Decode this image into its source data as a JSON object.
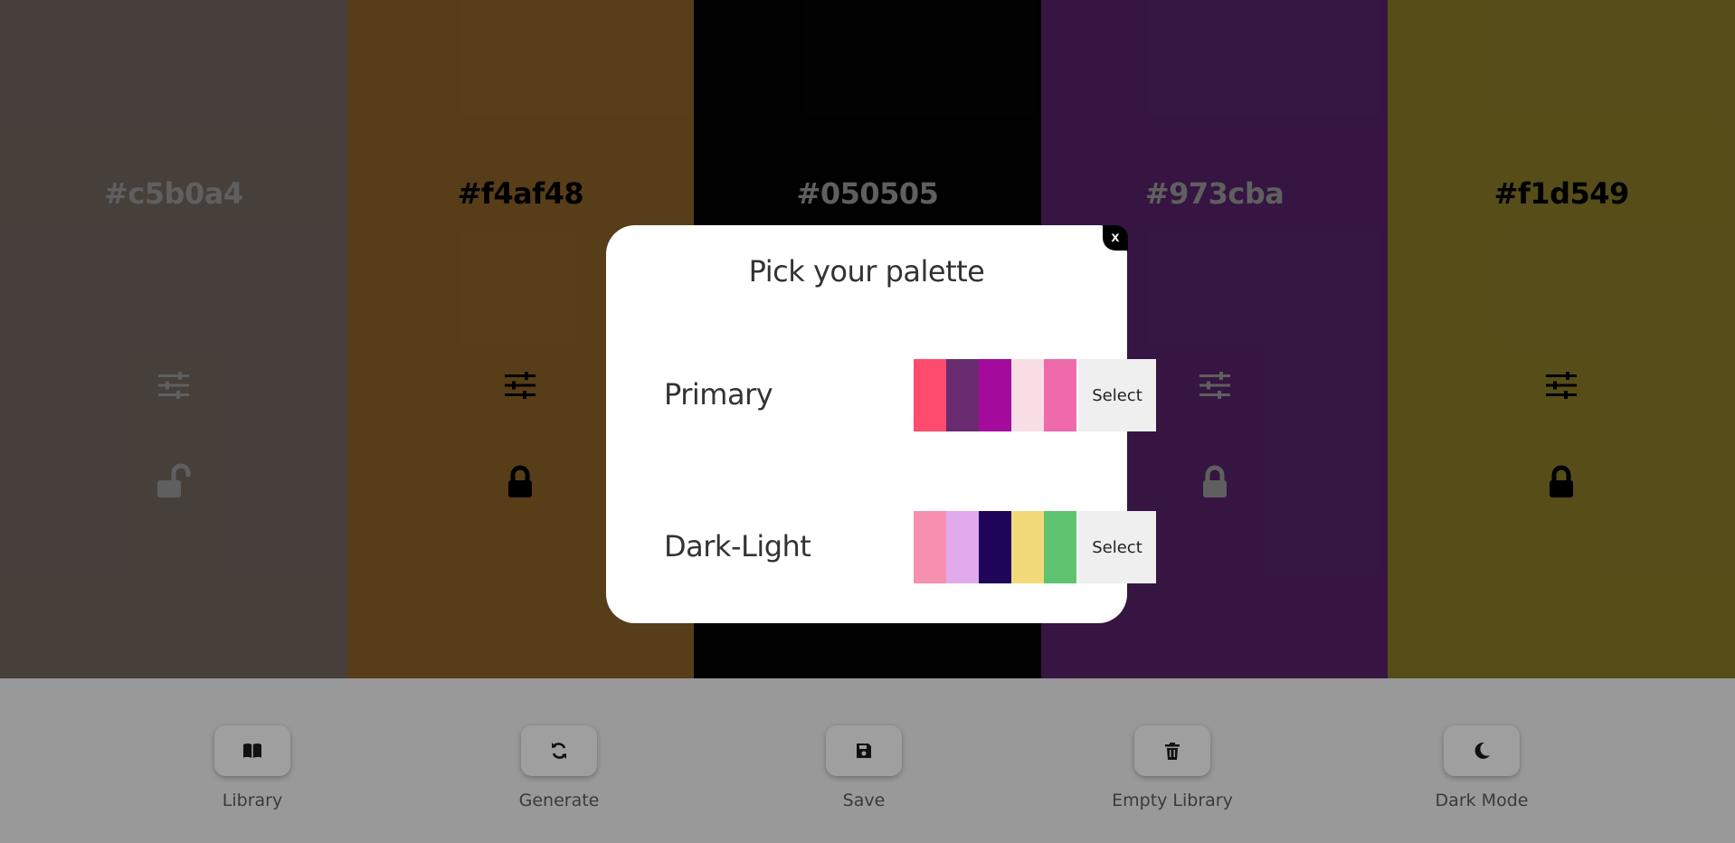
{
  "palette": [
    {
      "hex": "#c5b0a4",
      "bg": "#766962",
      "text_color": "#9e9e9e",
      "icon_color": "#9e9e9e",
      "locked": false
    },
    {
      "hex": "#f4af48",
      "bg": "#92682b",
      "text_color": "#000000",
      "icon_color": "#000000",
      "locked": true
    },
    {
      "hex": "#050505",
      "bg": "#030303",
      "text_color": "#9e9e9e",
      "icon_color": "#9e9e9e",
      "locked": true
    },
    {
      "hex": "#973cba",
      "bg": "#5a246f",
      "text_color": "#9e9e9e",
      "icon_color": "#9e9e9e",
      "locked": true
    },
    {
      "hex": "#f1d549",
      "bg": "#90802b",
      "text_color": "#000000",
      "icon_color": "#000000",
      "locked": true
    }
  ],
  "popup": {
    "title": "Pick your palette",
    "close_label": "x",
    "palettes": [
      {
        "name": "Primary",
        "swatches": [
          "#ff4b6e",
          "#6a2c70",
          "#a40a9b",
          "#f8dde5",
          "#ee6aac"
        ],
        "select_label": "Select"
      },
      {
        "name": "Dark-Light",
        "swatches": [
          "#f78fae",
          "#e0aaec",
          "#1e0559",
          "#f2da7a",
          "#5ec46f"
        ],
        "select_label": "Select"
      }
    ]
  },
  "controls": [
    {
      "label": "Library",
      "icon": "book-icon"
    },
    {
      "label": "Generate",
      "icon": "refresh-icon"
    },
    {
      "label": "Save",
      "icon": "save-icon"
    },
    {
      "label": "Empty Library",
      "icon": "trash-icon"
    },
    {
      "label": "Dark Mode",
      "icon": "moon-icon"
    }
  ]
}
